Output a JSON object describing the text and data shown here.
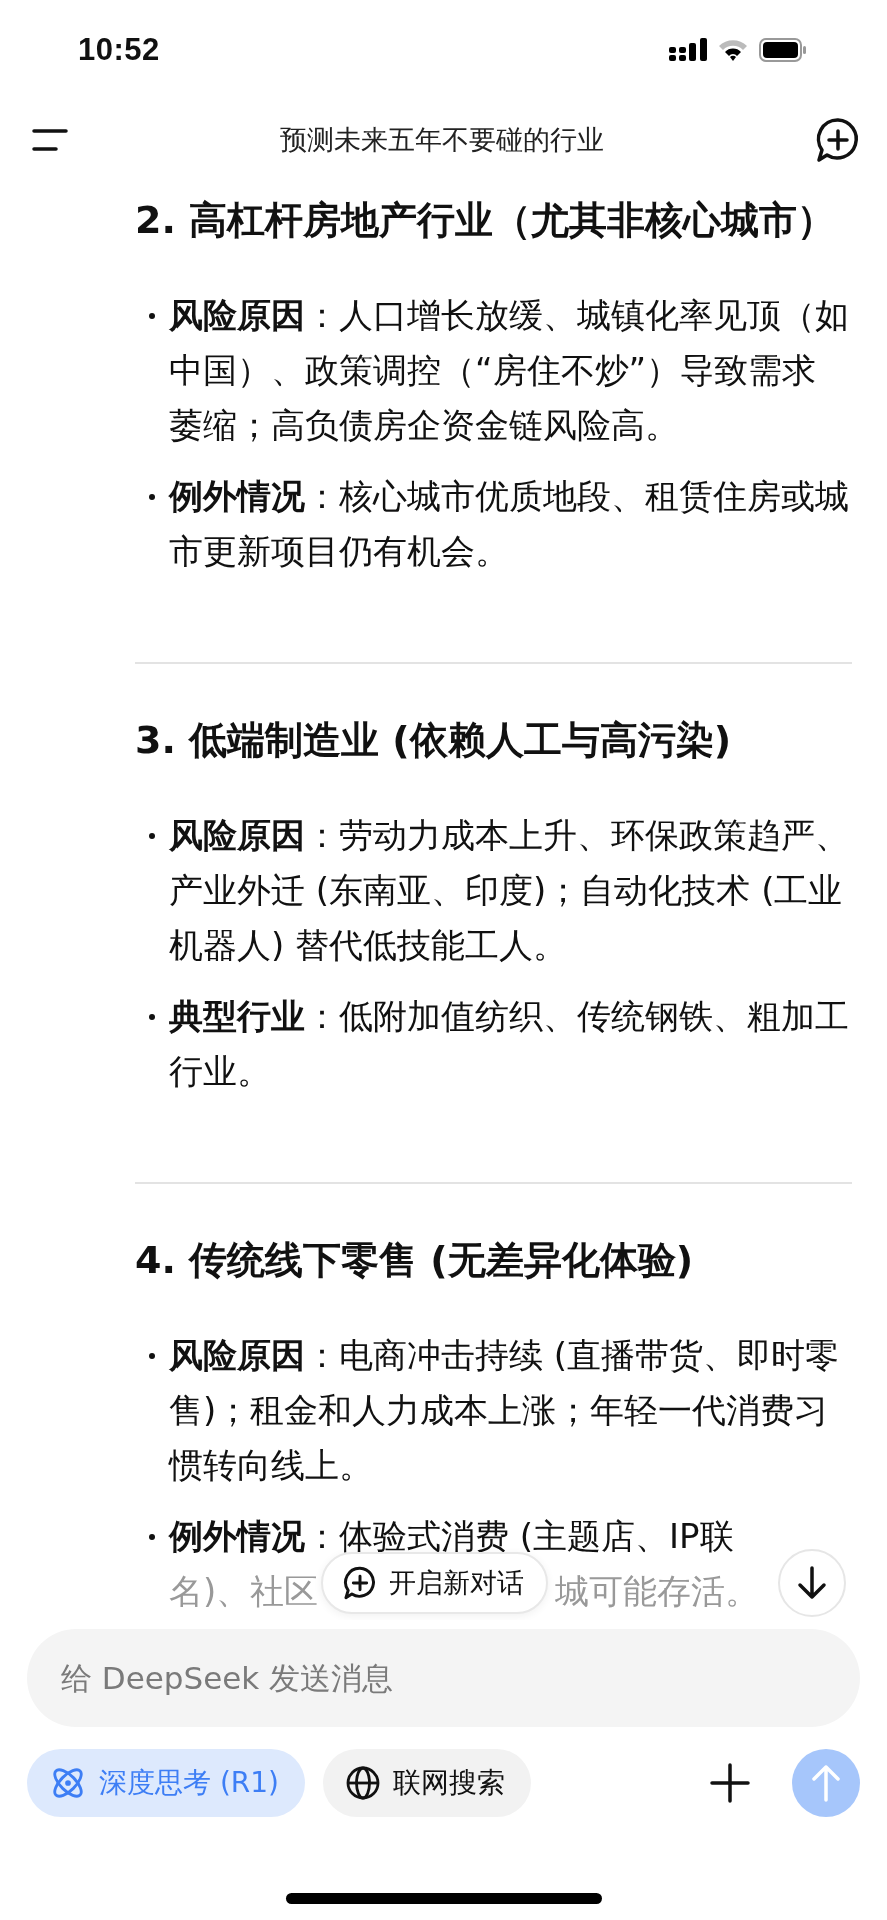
{
  "status_bar": {
    "time": "10:52"
  },
  "header": {
    "title": "预测未来五年不要碰的行业"
  },
  "sections": [
    {
      "heading": "2. 高杠杆房地产行业（尤其非核心城市）",
      "divider_after": true,
      "items": [
        {
          "text": "**风险原因**：人口增长放缓、城镇化率见顶（如中国）、政策调控（“房住不炒”）导致需求萎缩；高负债房企资金链风险高。"
        },
        {
          "text": "**例外情况**：核心城市优质地段、租赁住房或城市更新项目仍有机会。"
        }
      ]
    },
    {
      "heading": "3. 低端制造业 (依赖人工与高污染)",
      "divider_after": true,
      "items": [
        {
          "text": "**风险原因**：劳动力成本上升、环保政策趋严、产业外迁 (东南亚、印度)；自动化技术 (工业机器人) 替代低技能工人。"
        },
        {
          "text": "**典型行业**：低附加值纺织、传统钢铁、粗加工行业。"
        }
      ]
    },
    {
      "heading": "4. 传统线下零售 (无差异化体验)",
      "divider_after": false,
      "items": [
        {
          "text": "**风险原因**：电商冲击持续 (直播带货、即时零售)；租金和人力成本上涨；年轻一代消费习惯转向线上。"
        },
        {
          "text": "**例外情况**：体验式消费 (主题店、IP联",
          "text_faded": "名)、社区",
          "text_after_cover": "城可能存活。"
        }
      ]
    }
  ],
  "floating": {
    "new_chat": "开启新对话"
  },
  "composer": {
    "placeholder": "给 DeepSeek 发送消息",
    "toggles": [
      {
        "kind": "think",
        "label": "深度思考 (R1)",
        "selected": true
      },
      {
        "kind": "web",
        "label": "联网搜索",
        "selected": false
      }
    ],
    "send_disabled": true
  }
}
